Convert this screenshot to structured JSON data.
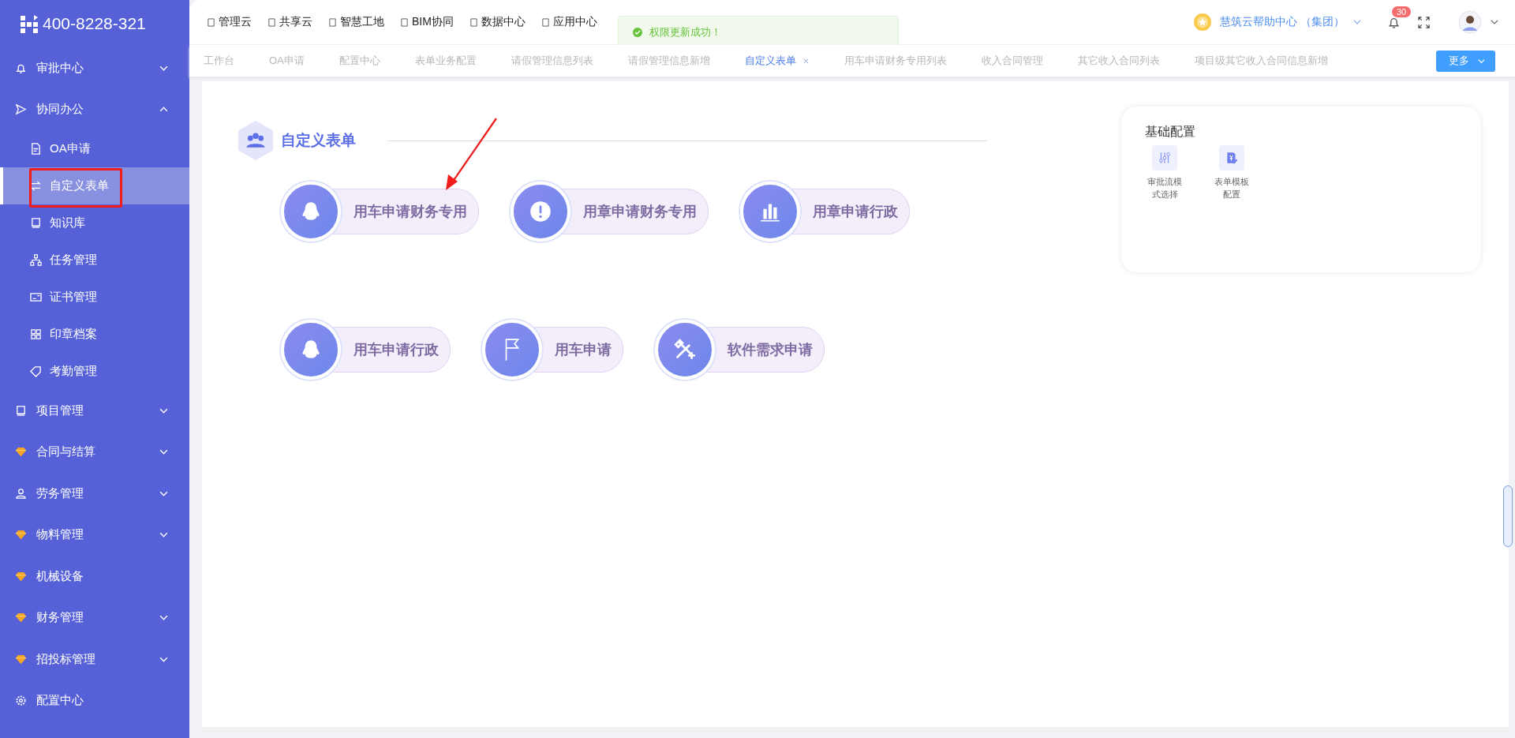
{
  "logo": {
    "phone": "400-8228-321"
  },
  "sidebar": {
    "items": [
      {
        "kind": "group",
        "label": "审批中心",
        "expanded": false
      },
      {
        "kind": "group",
        "label": "协同办公",
        "expanded": true,
        "children": [
          {
            "label": "OA申请",
            "selected": false
          },
          {
            "label": "自定义表单",
            "selected": true
          },
          {
            "label": "知识库",
            "selected": false
          },
          {
            "label": "任务管理",
            "selected": false
          },
          {
            "label": "证书管理",
            "selected": false
          },
          {
            "label": "印章档案",
            "selected": false
          },
          {
            "label": "考勤管理",
            "selected": false
          }
        ]
      },
      {
        "kind": "group",
        "label": "项目管理",
        "expanded": false
      },
      {
        "kind": "group",
        "label": "合同与结算",
        "expanded": false
      },
      {
        "kind": "group",
        "label": "劳务管理",
        "expanded": false
      },
      {
        "kind": "group",
        "label": "物料管理",
        "expanded": false
      },
      {
        "kind": "link",
        "label": "机械设备"
      },
      {
        "kind": "group",
        "label": "财务管理",
        "expanded": false
      },
      {
        "kind": "group",
        "label": "招投标管理",
        "expanded": false
      },
      {
        "kind": "link",
        "label": "配置中心"
      }
    ]
  },
  "top_nav": [
    "管理云",
    "共享云",
    "智慧工地",
    "BIM协同",
    "数据中心",
    "应用中心"
  ],
  "toast": {
    "message": "权限更新成功！"
  },
  "account": {
    "org": "慧筑云帮助中心 （集团）",
    "notifications": "30"
  },
  "tabs": [
    {
      "label": "工作台",
      "selected": false
    },
    {
      "label": "OA申请",
      "selected": false
    },
    {
      "label": "配置中心",
      "selected": false
    },
    {
      "label": "表单业务配置",
      "selected": false
    },
    {
      "label": "请假管理信息列表",
      "selected": false
    },
    {
      "label": "请假管理信息新增",
      "selected": false
    },
    {
      "label": "自定义表单",
      "selected": true
    },
    {
      "label": "用车申请财务专用列表",
      "selected": false
    },
    {
      "label": "收入合同管理",
      "selected": false
    },
    {
      "label": "其它收入合同列表",
      "selected": false
    },
    {
      "label": "项目级其它收入合同信息新增",
      "selected": false
    }
  ],
  "more_button": "更多",
  "section": {
    "title": "自定义表单",
    "rows": [
      [
        "用车申请财务专用",
        "用章申请财务专用",
        "用章申请行政"
      ],
      [
        "用车申请行政",
        "用车申请",
        "软件需求申请"
      ]
    ]
  },
  "basic_config": {
    "title": "基础配置",
    "items": [
      "审批流模式选择",
      "表单模板配置"
    ]
  }
}
